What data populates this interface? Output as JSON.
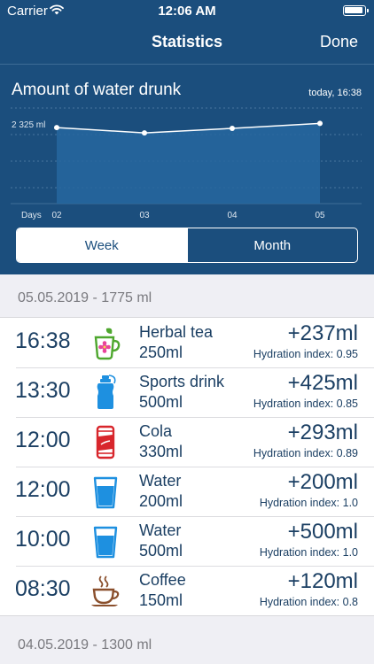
{
  "status_bar": {
    "carrier": "Carrier",
    "time": "12:06 AM"
  },
  "nav": {
    "title": "Statistics",
    "done_label": "Done"
  },
  "chart": {
    "title": "Amount of water drunk",
    "timestamp": "today, 16:38"
  },
  "chart_data": {
    "type": "area",
    "title": "Amount of water drunk",
    "x": [
      "02",
      "03",
      "04",
      "05"
    ],
    "x_prefix_label": "Days",
    "y_annotation": "2 325 ml",
    "series": [
      {
        "values": [
          1850,
          1720,
          1830,
          1950
        ]
      }
    ],
    "ylim": [
      0,
      2325
    ],
    "grid": "horizontal dotted",
    "colors": {
      "line": "#ffffff",
      "fill": "#26679f"
    }
  },
  "segments": {
    "week": "Week",
    "month": "Month",
    "selected": "week"
  },
  "sections": [
    {
      "header": "05.05.2019 - 1775 ml"
    },
    {
      "header": "04.05.2019 - 1300 ml"
    }
  ],
  "entries": [
    {
      "time": "16:38",
      "icon": "herbal-tea-icon",
      "name": "Herbal tea",
      "volume": "250ml",
      "amount": "+237ml",
      "index": "Hydration index: 0.95"
    },
    {
      "time": "13:30",
      "icon": "sports-drink-icon",
      "name": "Sports drink",
      "volume": "500ml",
      "amount": "+425ml",
      "index": "Hydration index: 0.85"
    },
    {
      "time": "12:00",
      "icon": "cola-icon",
      "name": "Cola",
      "volume": "330ml",
      "amount": "+293ml",
      "index": "Hydration index: 0.89"
    },
    {
      "time": "12:00",
      "icon": "water-glass-icon",
      "name": "Water",
      "volume": "200ml",
      "amount": "+200ml",
      "index": "Hydration index: 1.0"
    },
    {
      "time": "10:00",
      "icon": "water-glass-icon",
      "name": "Water",
      "volume": "500ml",
      "amount": "+500ml",
      "index": "Hydration index: 1.0"
    },
    {
      "time": "08:30",
      "icon": "coffee-icon",
      "name": "Coffee",
      "volume": "150ml",
      "amount": "+120ml",
      "index": "Hydration index: 0.8"
    }
  ],
  "colors": {
    "header_bg": "#1b4e7d",
    "text_dark": "#1b3f63",
    "list_bg": "#ffffff",
    "page_bg": "#efeff4"
  }
}
